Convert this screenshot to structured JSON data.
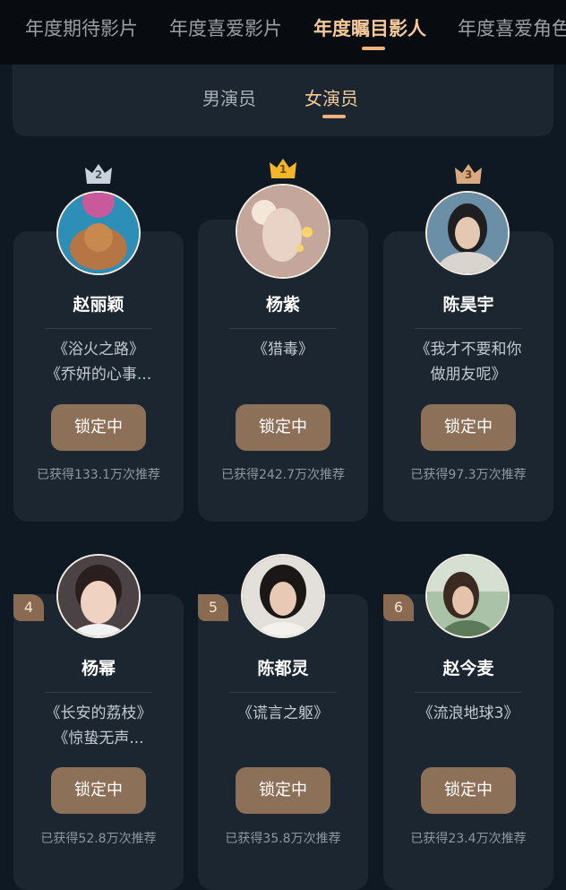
{
  "top_tabs": [
    "年度期待影片",
    "年度喜爱影片",
    "年度瞩目影人",
    "年度喜爱角色"
  ],
  "top_tabs_active": 2,
  "sub_tabs": [
    "男演员",
    "女演员"
  ],
  "sub_tabs_active": 1,
  "colors": {
    "accent": "#f3c99a",
    "button": "#8d7058",
    "card": "#1b2631",
    "background": "#0f1923"
  },
  "cards": [
    {
      "rank": "2",
      "name": "赵丽颖",
      "works": [
        "《浴火之路》",
        "《乔妍的心事..."
      ],
      "button": "锁定中",
      "count": "已获得133.1万次推荐"
    },
    {
      "rank": "1",
      "name": "杨紫",
      "works": [
        "《猎毒》"
      ],
      "button": "锁定中",
      "count": "已获得242.7万次推荐"
    },
    {
      "rank": "3",
      "name": "陈昊宇",
      "works": [
        "《我才不要和你",
        "做朋友呢》"
      ],
      "button": "锁定中",
      "count": "已获得97.3万次推荐"
    },
    {
      "rank": "4",
      "name": "杨幂",
      "works": [
        "《长安的荔枝》",
        "《惊蛰无声..."
      ],
      "button": "锁定中",
      "count": "已获得52.8万次推荐"
    },
    {
      "rank": "5",
      "name": "陈都灵",
      "works": [
        "《谎言之躯》"
      ],
      "button": "锁定中",
      "count": "已获得35.8万次推荐"
    },
    {
      "rank": "6",
      "name": "赵今麦",
      "works": [
        "《流浪地球3》"
      ],
      "button": "锁定中",
      "count": "已获得23.4万次推荐"
    }
  ]
}
